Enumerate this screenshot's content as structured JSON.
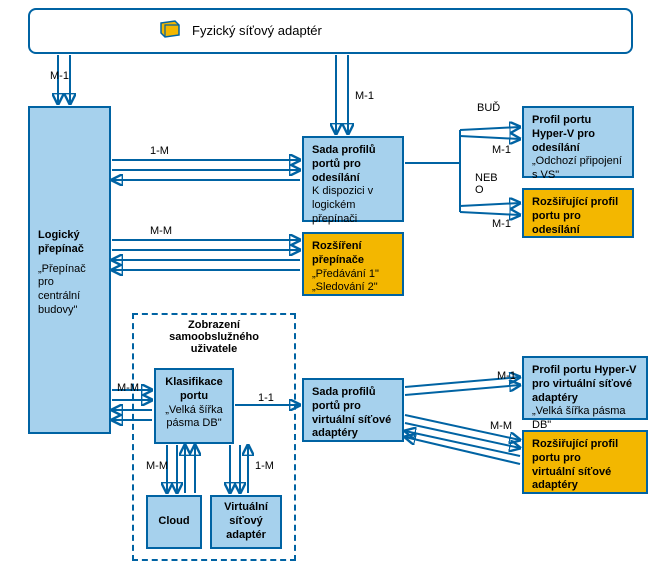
{
  "top_box": {
    "label": "Fyzický síťový adaptér"
  },
  "logical_switch": {
    "title": "Logický\npřepínač",
    "sub": "„Přepínač pro\ncentrální\nbudovy\""
  },
  "uplink_set": {
    "title": "Sada profilů\nportů pro\nodesílání",
    "sub": "K dispozici v\nlogickém\npřepínači"
  },
  "switch_ext": {
    "title": "Rozšíření\npřepínače",
    "sub": "„Předávání 1\"\n„Sledování 2\""
  },
  "hv_uplink": {
    "title": "Profil portu\nHyper-V pro\nodesílání",
    "sub": "„Odchozí připojení\ns VS\""
  },
  "ext_uplink": {
    "title": "Rozšiřující profil\nportu pro\nodesílání"
  },
  "selfservice_view": "Zobrazení\nsamoobslužného\nuživatele",
  "port_class": {
    "title": "Klasifikace\nportu",
    "sub": "„Velká šířka\npásma DB\""
  },
  "cloud": {
    "title": "Cloud"
  },
  "vnic": {
    "title": "Virtuální\nsíťový\nadaptér"
  },
  "vnic_set": {
    "title": "Sada profilů\nportů pro\nvirtuální síťové\nadaptéry"
  },
  "hv_vnic": {
    "title": "Profil portu Hyper-V\npro virtuální síťové\nadaptéry",
    "sub": "„Velká šířka pásma DB\""
  },
  "ext_vnic": {
    "title": "Rozšiřující profil\nportu pro\nvirtuální síťové\nadaptéry"
  },
  "edge_labels": {
    "m1_left": "M-1",
    "m1_mid": "M-1",
    "one_m": "1-M",
    "mm1": "M-M",
    "mm2": "M-M",
    "mm3": "M-M",
    "mm4": "M-M",
    "one_m2": "1-M",
    "one_one": "1-1",
    "bud": "BUĎ",
    "nebo": "NEB\nO",
    "m1_top": "M-1",
    "m1_bot": "M-1",
    "m1_v": "M-1"
  }
}
